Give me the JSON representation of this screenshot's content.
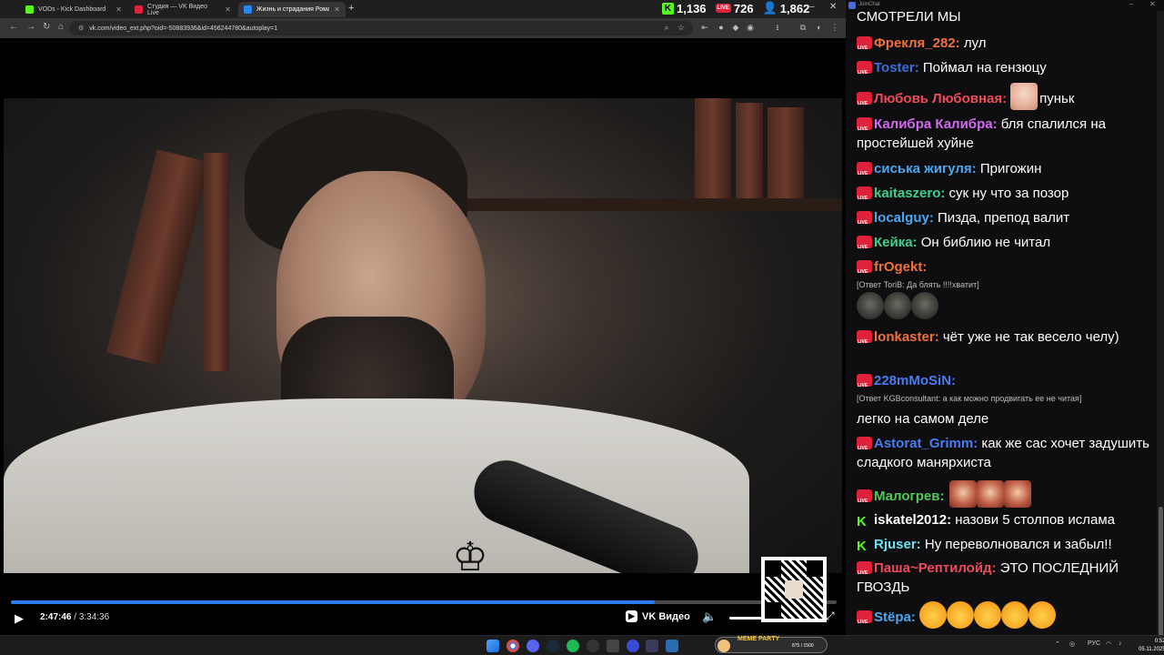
{
  "browser": {
    "tabs": [
      {
        "label": "VODs - Kick Dashboard",
        "color": "#53fc18"
      },
      {
        "label": "Студия — VK Видео Live",
        "color": "#e0213a"
      },
      {
        "label": "Жизнь и страдания Романа А…",
        "color": "#2787f5"
      }
    ],
    "url": "vk.com/video_ext.php?oid=-50883936&id=456244780&autoplay=1"
  },
  "counters": {
    "kick": "1,136",
    "vk_live": "726",
    "live_badge": "LIVE",
    "viewers": "1,862"
  },
  "player": {
    "current_time": "2:47:46",
    "separator": " / ",
    "duration": "3:34:36",
    "progress": 0.78,
    "brand": "VK Видео",
    "accent": "#2a7cf4"
  },
  "chat": {
    "title": "JoinChat",
    "messages": [
      {
        "platform": "none",
        "nick": "",
        "nick_color": "#ffffff",
        "text": "СМОТРЕЛИ МЫ"
      },
      {
        "platform": "vk",
        "nick": "Фрекля_282:",
        "nick_color": "#f0713b",
        "text": " лул"
      },
      {
        "platform": "vk",
        "nick": "Toster:",
        "nick_color": "#3a6fd8",
        "text": " Поймал на гензюцу"
      },
      {
        "platform": "vk",
        "nick": "Любовь Любовная:",
        "nick_color": "#f04a5a",
        "text": "пуньк",
        "emote": "woman"
      },
      {
        "platform": "vk",
        "nick": "Калибра Калибра:",
        "nick_color": "#d36bf0",
        "text": " бля спалился на простейшей хуйне"
      },
      {
        "platform": "vk",
        "nick": "сиська жигуля:",
        "nick_color": "#4aa8f0",
        "text": " Пригожин"
      },
      {
        "platform": "vk",
        "nick": "kaitaszero:",
        "nick_color": "#3ed08a",
        "text": " сук ну что за позор"
      },
      {
        "platform": "vk",
        "nick": "localguy:",
        "nick_color": "#4aa8f0",
        "text": " Пизда, препод валит"
      },
      {
        "platform": "vk",
        "nick": "Кейка:",
        "nick_color": "#3ed08a",
        "text": " Он библию не читал"
      },
      {
        "platform": "vk",
        "nick": "frOgekt:",
        "nick_color": "#f0713b",
        "text": "",
        "reply": "[Ответ ToriB: Да блять !!!!хватит]"
      },
      {
        "platform": "vk",
        "nick": "lonkaster:",
        "nick_color": "#f0713b",
        "text": " чёт уже не так весело челу)"
      },
      {
        "platform": "vk",
        "nick": "228mMoSiN:",
        "nick_color": "#4a7bf0",
        "text": "",
        "reply": "[Ответ KGBconsultant: а как можно продвигать ее не читая]",
        "after": "легко на самом деле"
      },
      {
        "platform": "vk",
        "nick": "Astorat_Grimm:",
        "nick_color": "#4a7bf0",
        "text": " как же сас хочет задушить сладкого маняpхиста"
      },
      {
        "platform": "vk",
        "nick": "Малогрев:",
        "nick_color": "#53c957",
        "text": "",
        "emote": "man3"
      },
      {
        "platform": "kick",
        "nick": "iskatel2012:",
        "nick_color": "#ffffff",
        "text": " назови 5 столпов ислама"
      },
      {
        "platform": "kick",
        "nick": "Rjuser:",
        "nick_color": "#6ee0f0",
        "text": " Ну переволновался и забыл!!"
      },
      {
        "platform": "vk",
        "nick": "Паша~Рептилойд:",
        "nick_color": "#f04a5a",
        "text": " ЭТО ПОСЛЕДНИЙ ГВОЗДЬ"
      },
      {
        "platform": "vk",
        "nick": "Stёpa:",
        "nick_color": "#4aa8f0",
        "text": "",
        "emote": "sad5"
      }
    ]
  },
  "taskbar": {
    "meme_label": "MEME PARTY",
    "meme_value": "875 / 1500",
    "lang": "РУС",
    "time": "0:52",
    "date": "05.11.2025"
  }
}
